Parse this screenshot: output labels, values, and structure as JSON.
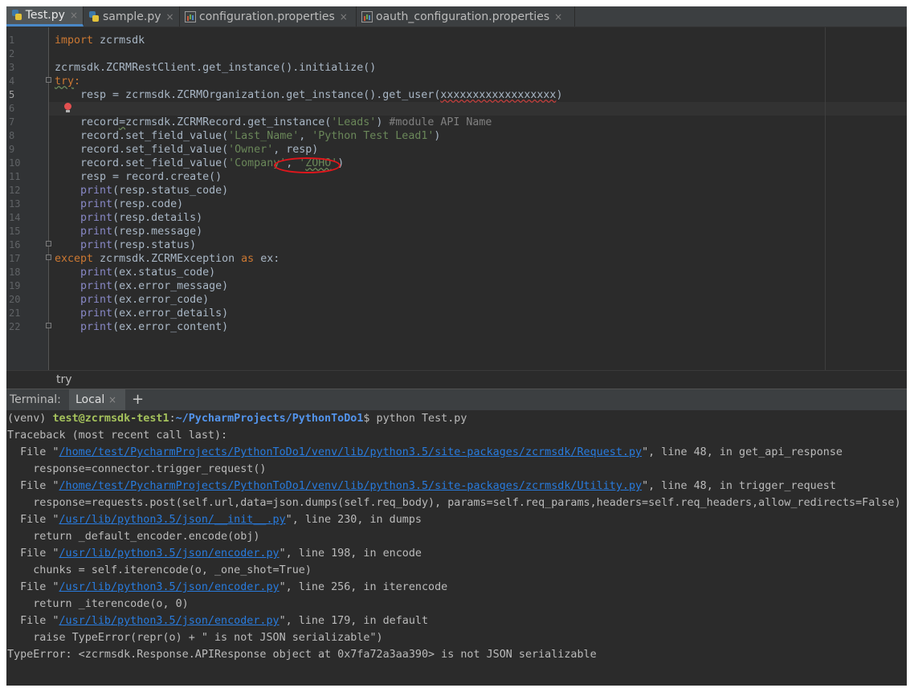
{
  "tabs": [
    {
      "label": "Test.py",
      "icon": "python-file-icon",
      "active": true
    },
    {
      "label": "sample.py",
      "icon": "python-file-icon"
    },
    {
      "label": "configuration.properties",
      "icon": "properties-file-icon"
    },
    {
      "label": "oauth_configuration.properties",
      "icon": "properties-file-icon"
    }
  ],
  "tab_close_glyph": "×",
  "gutter": {
    "line_numbers": [
      "1",
      "2",
      "3",
      "4",
      "5",
      "6",
      "7",
      "8",
      "9",
      "10",
      "11",
      "12",
      "13",
      "14",
      "15",
      "16",
      "17",
      "18",
      "19",
      "20",
      "21",
      "22"
    ],
    "current_line": "5"
  },
  "code": {
    "l1": {
      "kw": "import",
      "rest": " zcrmsdk"
    },
    "l3": "zcrmsdk.ZCRMRestClient.get_instance().initialize()",
    "l4": {
      "kw": "try",
      "rest": ":"
    },
    "l5": {
      "pre": "    resp = zcrmsdk.ZCRMOrganization.get_instance().get_user(",
      "arg": "xxxxxxxxxxxxxxxxxx",
      "post": ")"
    },
    "l7": {
      "pre": "    record",
      "eq": "=",
      "mid": "zcrmsdk.ZCRMRecord.get_instance(",
      "str": "'Leads'",
      "close": ")",
      "comment": " #module API Name"
    },
    "l8": {
      "pre": "    record.set_field_value(",
      "s1": "'Last_Name'",
      "sep": ", ",
      "s2": "'Python Test Lead1'",
      "post": ")"
    },
    "l9": {
      "pre": "    record.set_field_value(",
      "s1": "'Owner'",
      "sep": ", ",
      "arg": "resp",
      "post": ")"
    },
    "l10": {
      "pre": "    record.set_field_value(",
      "s1": "'Company'",
      "sep": ", ",
      "q1": "'",
      "s2": "ZOHO",
      "q2": "'",
      "post": ")"
    },
    "l11": "    resp = record.create()",
    "l12": {
      "fn": "print",
      "rest": "(resp.status_code)"
    },
    "l13": {
      "fn": "print",
      "rest": "(resp.code)"
    },
    "l14": {
      "fn": "print",
      "rest": "(resp.details)"
    },
    "l15": {
      "fn": "print",
      "rest": "(resp.message)"
    },
    "l16": {
      "fn": "print",
      "rest": "(resp.status)"
    },
    "l17": {
      "kw": "except",
      "mid": " zcrmsdk.ZCRMException ",
      "kw2": "as",
      "rest": " ex:"
    },
    "l18": {
      "fn": "print",
      "rest": "(ex.status_code)"
    },
    "l19": {
      "fn": "print",
      "rest": "(ex.error_message)"
    },
    "l20": {
      "fn": "print",
      "rest": "(ex.error_code)"
    },
    "l21": {
      "fn": "print",
      "rest": "(ex.error_details)"
    },
    "l22": {
      "fn": "print",
      "rest": "(ex.error_content)"
    }
  },
  "breadcrumb": "try",
  "terminal": {
    "label": "Terminal:",
    "tab": "Local",
    "add": "+",
    "prompt": {
      "venv": "(venv) ",
      "user": "test@zcrmsdk-test1",
      "colon": ":",
      "path": "~/PycharmProjects/PythonToDo1",
      "dollar": "$ python Test.py"
    },
    "traceback_header": "Traceback (most recent call last):",
    "frames": [
      {
        "file": "/home/test/PycharmProjects/PythonToDo1/venv/lib/python3.5/site-packages/zcrmsdk/Request.py",
        "info": "\", line 48, in get_api_response",
        "code": "    response=connector.trigger_request()"
      },
      {
        "file": "/home/test/PycharmProjects/PythonToDo1/venv/lib/python3.5/site-packages/zcrmsdk/Utility.py",
        "info": "\", line 48, in trigger_request",
        "code": "    response=requests.post(self.url,data=json.dumps(self.req_body), params=self.req_params,headers=self.req_headers,allow_redirects=False)"
      },
      {
        "file": "/usr/lib/python3.5/json/__init__.py",
        "info": "\", line 230, in dumps",
        "code": "    return _default_encoder.encode(obj)"
      },
      {
        "file": "/usr/lib/python3.5/json/encoder.py",
        "info": "\", line 198, in encode",
        "code": "    chunks = self.iterencode(o, _one_shot=True)"
      },
      {
        "file": "/usr/lib/python3.5/json/encoder.py",
        "info": "\", line 256, in iterencode",
        "code": "    return _iterencode(o, 0)"
      },
      {
        "file": "/usr/lib/python3.5/json/encoder.py",
        "info": "\", line 179, in default",
        "code": "    raise TypeError(repr(o) + \" is not JSON serializable\")"
      }
    ],
    "frame_prefix": "  File \"",
    "error": "TypeError: <zcrmsdk.Response.APIResponse object at 0x7fa72a3aa390> is not JSON serializable"
  },
  "colors": {
    "keyword": "#cc7832",
    "string": "#6a8759",
    "builtin": "#8888c6",
    "link": "#287bde",
    "annotation": "#e0161c"
  }
}
